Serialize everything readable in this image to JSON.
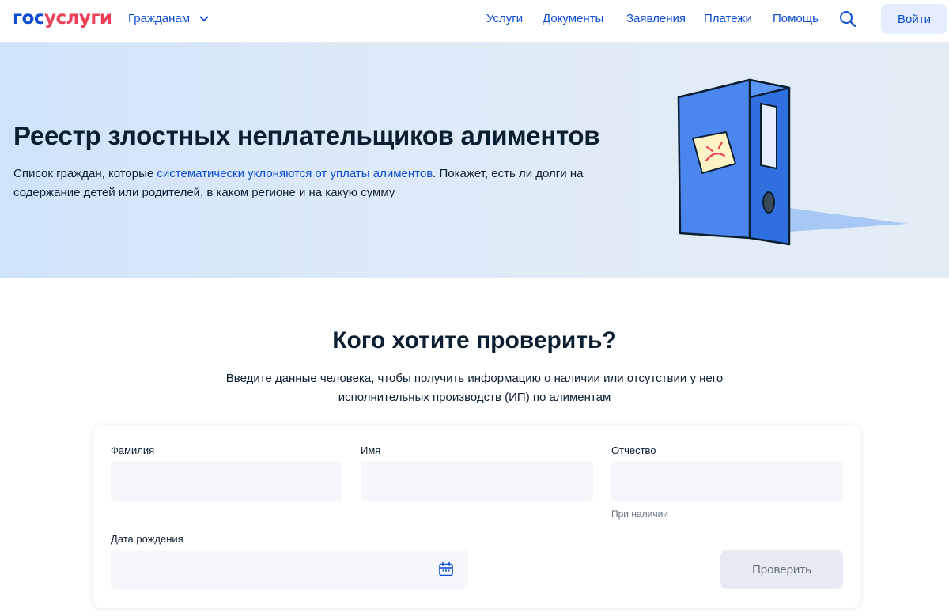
{
  "header": {
    "logo_part1": "гос",
    "logo_part2": "услуги",
    "audience": "Гражданам",
    "nav": [
      "Услуги",
      "Документы",
      "Заявления",
      "Платежи",
      "Помощь"
    ],
    "login_label": "Войти",
    "colors": {
      "brand_blue": "#0d4cd3",
      "brand_red": "#ee3f58"
    }
  },
  "hero": {
    "title": "Реестр злостных неплательщиков алиментов",
    "desc_before": "Список граждан, которые ",
    "desc_link": "систематически уклоняются от уплаты алиментов",
    "desc_after": ". Покажет, есть ли долги на содержание детей или родителей, в каком регионе и на какую сумму",
    "illustration": "blue-binder-with-sad-sticky-note"
  },
  "section": {
    "title": "Кого хотите проверить?",
    "description": "Введите данные человека, чтобы получить информацию о наличии или отсутствии у него исполнительных производств (ИП) по алиментам"
  },
  "form": {
    "surname_label": "Фамилия",
    "surname_value": "",
    "name_label": "Имя",
    "name_value": "",
    "patronymic_label": "Отчество",
    "patronymic_value": "",
    "patronymic_hint": "При наличии",
    "birthdate_label": "Дата рождения",
    "birthdate_value": "",
    "submit_label": "Проверить"
  }
}
